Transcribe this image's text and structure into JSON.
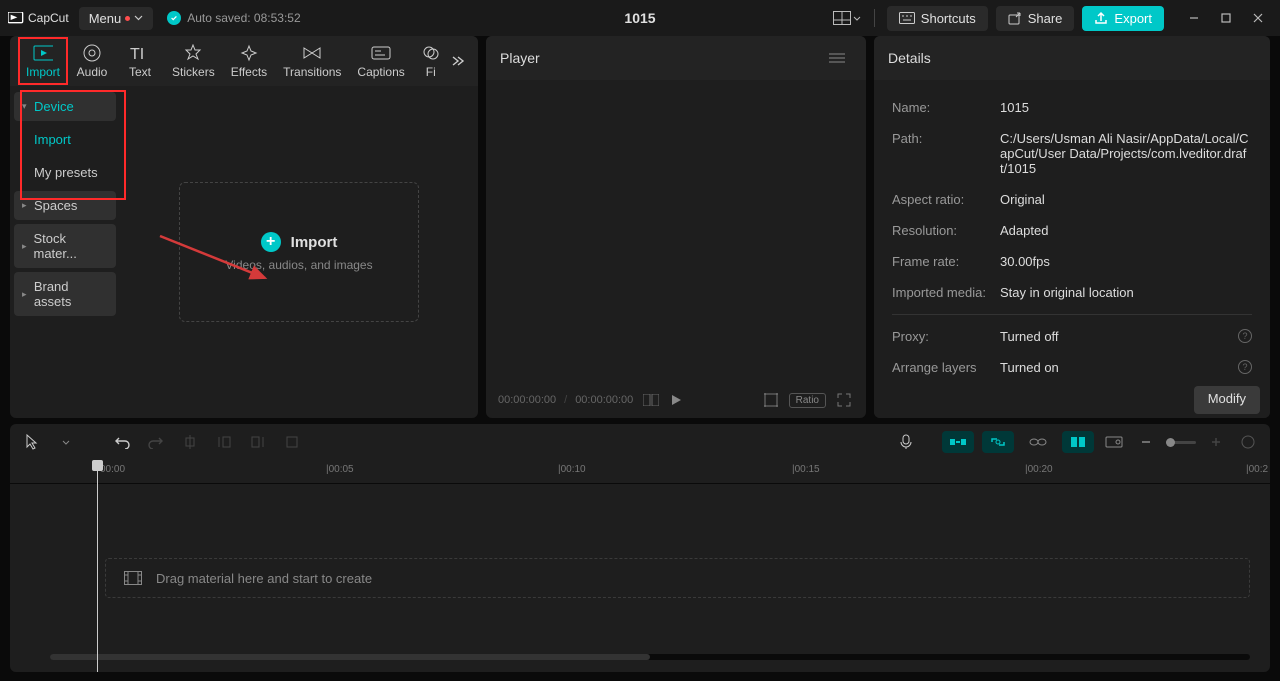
{
  "app": {
    "name": "CapCut"
  },
  "titlebar": {
    "menu": "Menu",
    "autosave": "Auto saved: 08:53:52",
    "project_title": "1015",
    "shortcuts": "Shortcuts",
    "share": "Share",
    "export": "Export"
  },
  "tabs": {
    "import": "Import",
    "audio": "Audio",
    "text": "Text",
    "stickers": "Stickers",
    "effects": "Effects",
    "transitions": "Transitions",
    "captions": "Captions",
    "filters_partial": "Fi"
  },
  "sidebar": {
    "device": "Device",
    "import": "Import",
    "my_presets": "My presets",
    "spaces": "Spaces",
    "stock": "Stock mater...",
    "brand": "Brand assets"
  },
  "import_panel": {
    "label": "Import",
    "hint": "Videos, audios, and images"
  },
  "player": {
    "title": "Player",
    "time_current": "00:00:00:00",
    "time_total": "00:00:00:00",
    "ratio": "Ratio"
  },
  "details": {
    "title": "Details",
    "name_label": "Name:",
    "name_value": "1015",
    "path_label": "Path:",
    "path_value": "C:/Users/Usman Ali Nasir/AppData/Local/CapCut/User Data/Projects/com.lveditor.draft/1015",
    "aspect_label": "Aspect ratio:",
    "aspect_value": "Original",
    "resolution_label": "Resolution:",
    "resolution_value": "Adapted",
    "framerate_label": "Frame rate:",
    "framerate_value": "30.00fps",
    "imported_label": "Imported media:",
    "imported_value": "Stay in original location",
    "proxy_label": "Proxy:",
    "proxy_value": "Turned off",
    "layers_label": "Arrange layers",
    "layers_value": "Turned on",
    "modify": "Modify"
  },
  "timeline": {
    "ticks": [
      "00:00",
      "|00:05",
      "|00:10",
      "|00:15",
      "|00:20",
      "|00:2"
    ],
    "drag_hint": "Drag material here and start to create"
  }
}
